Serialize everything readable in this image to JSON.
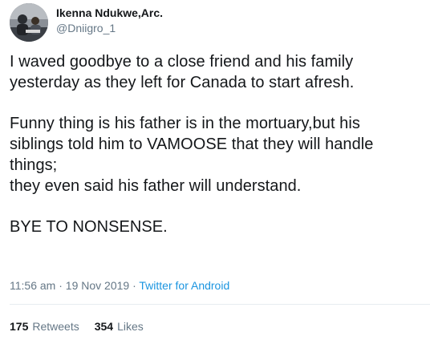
{
  "author": {
    "display_name": "Ikenna Ndukwe,Arc.",
    "handle": "@Dniigro_1"
  },
  "tweet": {
    "paragraph1": [
      "I waved goodbye to a close friend and his family",
      "yesterday as they left for Canada to start afresh."
    ],
    "paragraph2": [
      "Funny thing is his father is in the mortuary,but his",
      "siblings told him to VAMOOSE that they will handle",
      "things;",
      "they even said his father will understand."
    ],
    "paragraph3": [
      "BYE TO NONSENSE."
    ]
  },
  "meta": {
    "time": "11:56 am",
    "separator1": " · ",
    "date": "19 Nov 2019",
    "separator2": " · ",
    "source": "Twitter for Android"
  },
  "stats": {
    "retweets_count": "175",
    "retweets_label": "Retweets",
    "likes_count": "354",
    "likes_label": "Likes"
  },
  "colors": {
    "text": "#14171a",
    "secondary": "#657786",
    "link": "#1b95e0",
    "divider": "#e6ecf0"
  }
}
